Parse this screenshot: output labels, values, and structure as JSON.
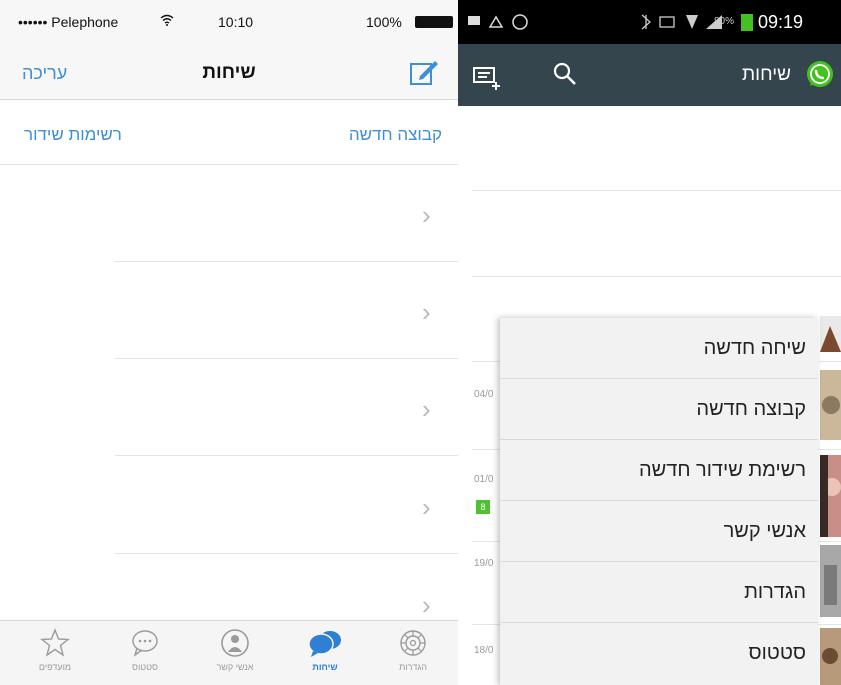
{
  "ios": {
    "status": {
      "carrier": "•••••• Pelephone",
      "time": "10:10",
      "battery": "100%"
    },
    "nav": {
      "edit_label": "עריכה",
      "title": "שיחות"
    },
    "links": {
      "broadcast_list": "רשימות שידור",
      "new_group": "קבוצה חדשה"
    },
    "rows": [
      {
        "chevron": "›"
      },
      {
        "chevron": "›"
      },
      {
        "chevron": "›"
      },
      {
        "chevron": "›"
      },
      {
        "chevron": "›"
      }
    ],
    "tabs": [
      {
        "label": "מועדפים",
        "icon": "star-icon"
      },
      {
        "label": "סטטוס",
        "icon": "speech-bubble-icon"
      },
      {
        "label": "אנשי קשר",
        "icon": "contact-icon"
      },
      {
        "label": "שיחות",
        "icon": "chats-icon",
        "active": true
      },
      {
        "label": "הגדרות",
        "icon": "gear-icon"
      }
    ]
  },
  "android": {
    "status": {
      "time": "09:19",
      "battery": "80%"
    },
    "bar": {
      "title": "שיחות"
    },
    "dates": [
      "04/0",
      "01/0",
      "19/0",
      "18/0"
    ],
    "badge": "8",
    "menu": [
      "שיחה חדשה",
      "קבוצה חדשה",
      "רשימת שידור חדשה",
      "אנשי קשר",
      "הגדרות",
      "סטטוס"
    ]
  },
  "colors": {
    "ios_accent": "#3d8fd8",
    "android_bar": "#34454d",
    "whatsapp_green": "#43c21f",
    "menu_bg": "#f2f2f2"
  }
}
